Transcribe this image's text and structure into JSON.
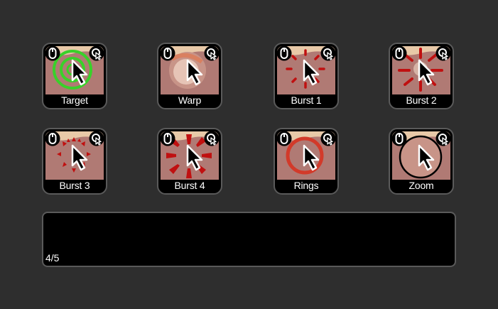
{
  "effects": [
    {
      "label": "Target",
      "icon": "target-icon"
    },
    {
      "label": "Warp",
      "icon": "warp-icon"
    },
    {
      "label": "Burst 1",
      "icon": "burst-1-icon"
    },
    {
      "label": "Burst 2",
      "icon": "burst-2-icon"
    },
    {
      "label": "Burst 3",
      "icon": "burst-3-icon"
    },
    {
      "label": "Burst 4",
      "icon": "burst-4-icon"
    },
    {
      "label": "Rings",
      "icon": "rings-icon"
    },
    {
      "label": "Zoom",
      "icon": "zoom-icon"
    }
  ],
  "status": {
    "page_indicator": "4/5"
  },
  "colors": {
    "background": "#2e2e2e",
    "tile_border": "#5a5a5a",
    "thumb_bg": "#b07a74",
    "target_ring": "#39d12a",
    "burst_red": "#c01010",
    "ring_red": "#d23a2a"
  }
}
